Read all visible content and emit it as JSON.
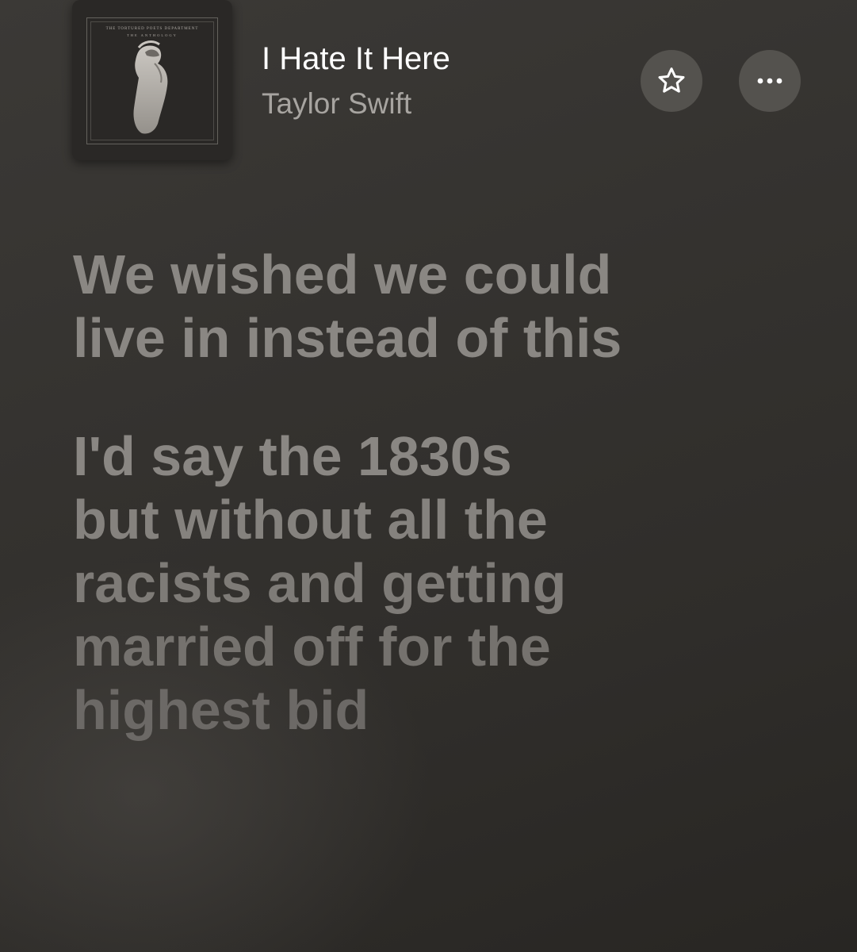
{
  "now_playing": {
    "title": "I Hate It Here",
    "artist": "Taylor Swift",
    "artwork": {
      "line1": "THE TORTURED POETS DEPARTMENT",
      "line2": "THE ANTHOLOGY"
    }
  },
  "controls": {
    "favorite_icon": "star-outline-icon",
    "more_icon": "ellipsis-icon"
  },
  "lyrics": {
    "stanza1": [
      "We wished we could",
      "live in instead of this"
    ],
    "stanza2": [
      "I'd say the 1830s",
      "but without all the",
      "racists and getting",
      "married off for the",
      "highest bid"
    ]
  },
  "colors": {
    "background": "#34322f",
    "lyric_text": "#8a8783",
    "artist_text": "#a7a4a0",
    "button_bg": "#5f5c58"
  }
}
